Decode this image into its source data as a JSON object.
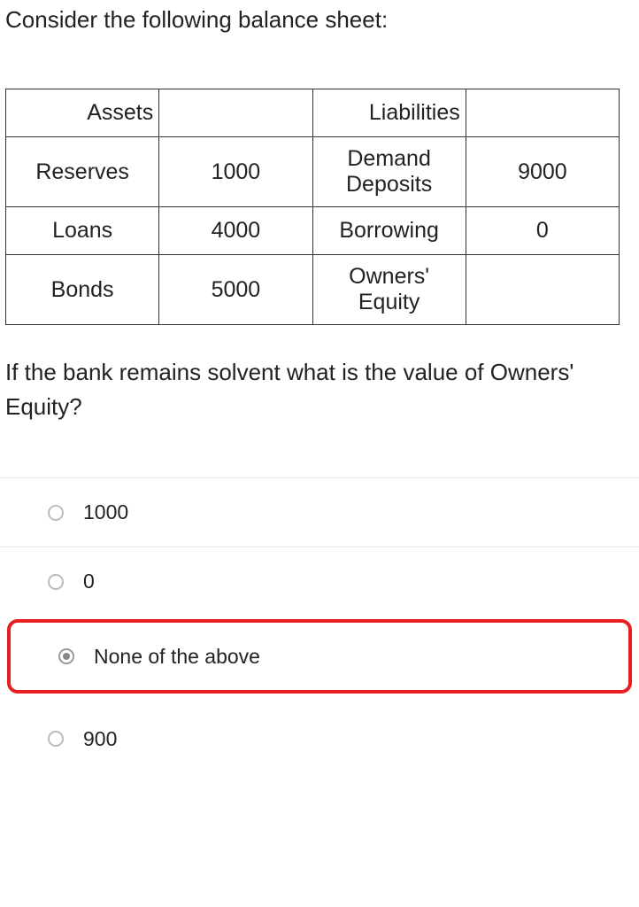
{
  "intro": "Consider the following balance sheet:",
  "table": {
    "header_assets": "Assets",
    "header_liabilities": "Liabilities",
    "rows": [
      {
        "a_label": "Reserves",
        "a_val": "1000",
        "l_label": "Demand Deposits",
        "l_val": "9000"
      },
      {
        "a_label": "Loans",
        "a_val": "4000",
        "l_label": "Borrowing",
        "l_val": "0"
      },
      {
        "a_label": "Bonds",
        "a_val": "5000",
        "l_label": "Owners' Equity",
        "l_val": ""
      }
    ]
  },
  "follow": "If the bank remains solvent what is the value of Owners' Equity?",
  "options": [
    {
      "label": "1000",
      "selected": false,
      "highlighted": false
    },
    {
      "label": "0",
      "selected": false,
      "highlighted": false
    },
    {
      "label": "None of the above",
      "selected": true,
      "highlighted": true
    },
    {
      "label": "900",
      "selected": false,
      "highlighted": false
    }
  ]
}
